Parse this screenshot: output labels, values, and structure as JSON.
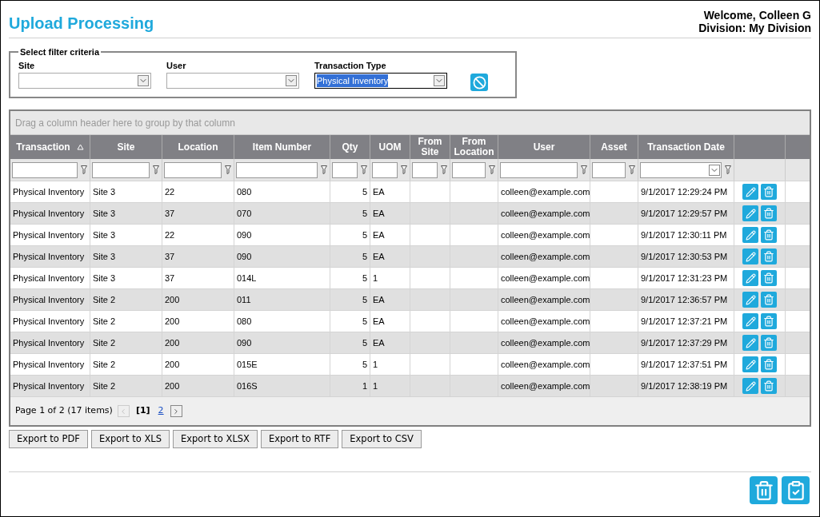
{
  "page": {
    "title": "Upload Processing",
    "welcome": "Welcome, Colleen G",
    "division": "Division: My Division"
  },
  "filter": {
    "legend": "Select filter criteria",
    "fields": [
      {
        "label": "Site",
        "highlighted": false
      },
      {
        "label": "User",
        "highlighted": false
      },
      {
        "label": "Transaction Type",
        "value": "Physical Inventory",
        "highlighted": true
      }
    ]
  },
  "grid": {
    "group_hint": "Drag a column header here to group by that column",
    "columns": [
      {
        "label": "Transaction",
        "sorted": true,
        "date_filter": false
      },
      {
        "label": "Site",
        "sorted": false,
        "date_filter": false
      },
      {
        "label": "Location",
        "sorted": false,
        "date_filter": false
      },
      {
        "label": "Item Number",
        "sorted": false,
        "date_filter": false
      },
      {
        "label": "Qty",
        "sorted": false,
        "date_filter": false
      },
      {
        "label": "UOM",
        "sorted": false,
        "date_filter": false
      },
      {
        "label": "From Site",
        "sorted": false,
        "date_filter": false
      },
      {
        "label": "From Location",
        "sorted": false,
        "date_filter": false
      },
      {
        "label": "User",
        "sorted": false,
        "date_filter": false
      },
      {
        "label": "Asset",
        "sorted": false,
        "date_filter": false
      },
      {
        "label": "Transaction Date",
        "sorted": false,
        "date_filter": true
      }
    ],
    "rows": [
      [
        "Physical Inventory",
        "Site 3",
        "22",
        "080",
        "5",
        "EA",
        null,
        null,
        "colleen@example.com",
        null,
        "9/1/2017 12:29:24 PM"
      ],
      [
        "Physical Inventory",
        "Site 3",
        "37",
        "070",
        "5",
        "EA",
        null,
        null,
        "colleen@example.com",
        null,
        "9/1/2017 12:29:57 PM"
      ],
      [
        "Physical Inventory",
        "Site 3",
        "22",
        "090",
        "5",
        "EA",
        null,
        null,
        "colleen@example.com",
        null,
        "9/1/2017 12:30:11 PM"
      ],
      [
        "Physical Inventory",
        "Site 3",
        "37",
        "090",
        "5",
        "EA",
        null,
        null,
        "colleen@example.com",
        null,
        "9/1/2017 12:30:53 PM"
      ],
      [
        "Physical Inventory",
        "Site 3",
        "37",
        "014L",
        "5",
        "1",
        null,
        null,
        "colleen@example.com",
        null,
        "9/1/2017 12:31:23 PM"
      ],
      [
        "Physical Inventory",
        "Site 2",
        "200",
        "011",
        "5",
        "EA",
        null,
        null,
        "colleen@example.com",
        null,
        "9/1/2017 12:36:57 PM"
      ],
      [
        "Physical Inventory",
        "Site 2",
        "200",
        "080",
        "5",
        "EA",
        null,
        null,
        "colleen@example.com",
        null,
        "9/1/2017 12:37:21 PM"
      ],
      [
        "Physical Inventory",
        "Site 2",
        "200",
        "090",
        "5",
        "EA",
        null,
        null,
        "colleen@example.com",
        null,
        "9/1/2017 12:37:29 PM"
      ],
      [
        "Physical Inventory",
        "Site 2",
        "200",
        "015E",
        "5",
        "1",
        null,
        null,
        "colleen@example.com",
        null,
        "9/1/2017 12:37:51 PM"
      ],
      [
        "Physical Inventory",
        "Site 2",
        "200",
        "016S",
        "1",
        "1",
        null,
        null,
        "colleen@example.com",
        null,
        "9/1/2017 12:38:19 PM"
      ]
    ],
    "pager": {
      "summary": "Page 1 of 2 (17 items)",
      "prev_disabled": true,
      "next_disabled": false,
      "pages": [
        {
          "label": "[1]",
          "selected": true
        },
        {
          "label": "2",
          "selected": false
        }
      ]
    }
  },
  "exports": [
    "Export to PDF",
    "Export to XLS",
    "Export to XLSX",
    "Export to RTF",
    "Export to CSV"
  ]
}
